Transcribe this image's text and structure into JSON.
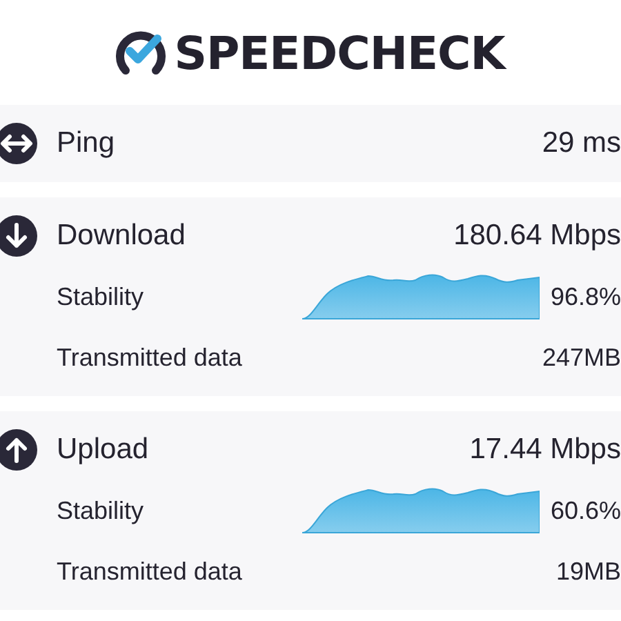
{
  "brand": "SPEEDCHECK",
  "metrics": [
    {
      "kind": "ping",
      "label": "Ping",
      "value": "29 ms"
    },
    {
      "kind": "download",
      "label": "Download",
      "value": "180.64 Mbps",
      "details": [
        {
          "kind": "graph",
          "label": "Stability",
          "value": "96.8%"
        },
        {
          "kind": "text",
          "label": "Transmitted data",
          "value": "247MB"
        }
      ]
    },
    {
      "kind": "upload",
      "label": "Upload",
      "value": "17.44 Mbps",
      "details": [
        {
          "kind": "graph",
          "label": "Stability",
          "value": "60.6%"
        },
        {
          "kind": "text",
          "label": "Transmitted data",
          "value": "19MB"
        }
      ]
    }
  ]
}
